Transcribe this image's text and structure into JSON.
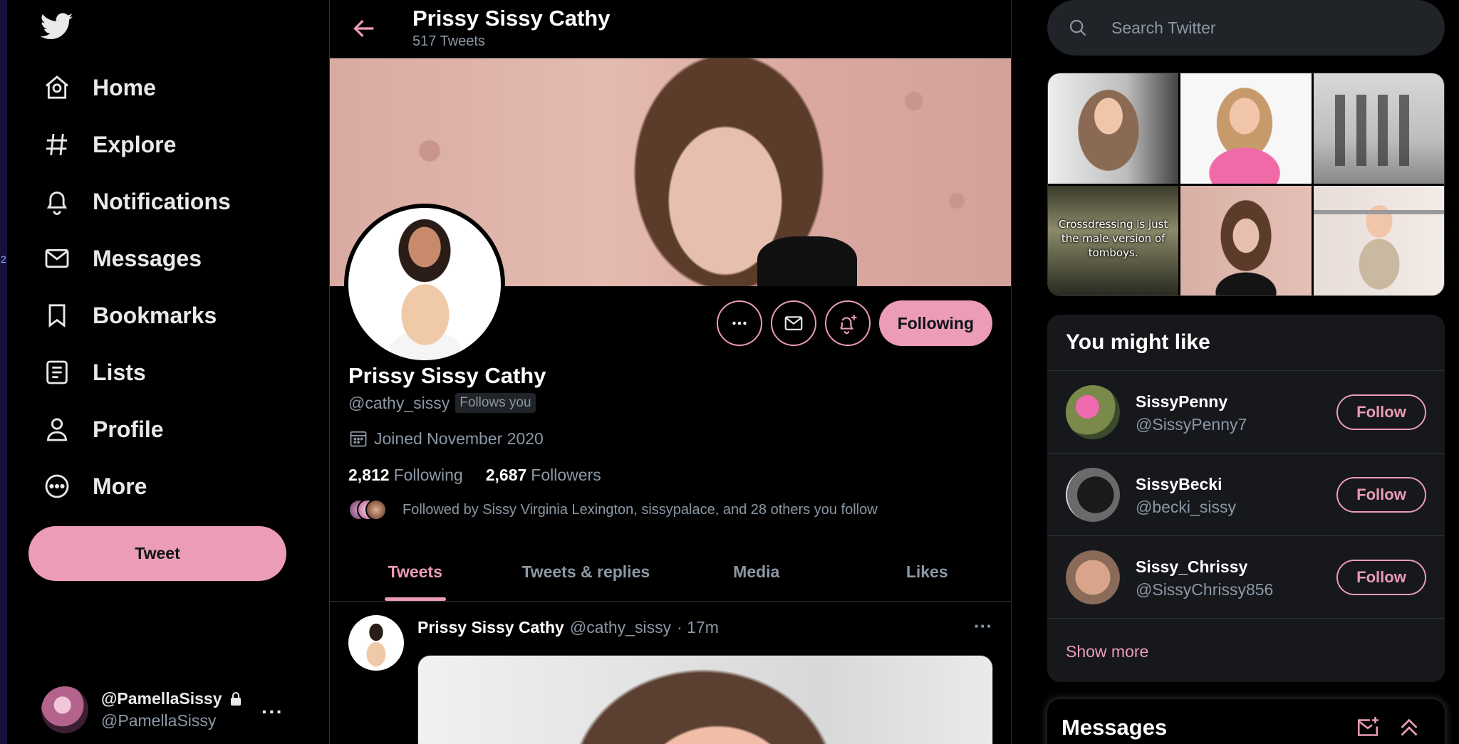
{
  "sidebar_marker": "2",
  "nav": {
    "items": [
      {
        "label": "Home",
        "icon": "home-icon"
      },
      {
        "label": "Explore",
        "icon": "hashtag-icon"
      },
      {
        "label": "Notifications",
        "icon": "bell-icon"
      },
      {
        "label": "Messages",
        "icon": "envelope-icon"
      },
      {
        "label": "Bookmarks",
        "icon": "bookmark-icon"
      },
      {
        "label": "Lists",
        "icon": "list-icon"
      },
      {
        "label": "Profile",
        "icon": "person-icon"
      },
      {
        "label": "More",
        "icon": "more-circle-icon"
      }
    ],
    "tweet_button": "Tweet",
    "account": {
      "name": "@PamellaSissy",
      "handle": "@PamellaSissy",
      "more": "···"
    }
  },
  "header": {
    "title": "Prissy Sissy Cathy",
    "subtitle": "517 Tweets"
  },
  "profile": {
    "name": "Prissy Sissy Cathy",
    "handle": "@cathy_sissy",
    "follows_you": "Follows you",
    "joined": "Joined November 2020",
    "following_count": "2,812",
    "following_label": "Following",
    "followers_count": "2,687",
    "followers_label": "Followers",
    "followed_by": "Followed by Sissy Virginia Lexington, sissypalace, and 28 others you follow",
    "following_button": "Following"
  },
  "tabs": [
    "Tweets",
    "Tweets & replies",
    "Media",
    "Likes"
  ],
  "active_tab": "Tweets",
  "tweet": {
    "name": "Prissy Sissy Cathy",
    "handle": "@cathy_sissy",
    "time": "· 17m"
  },
  "search": {
    "placeholder": "Search Twitter"
  },
  "media_grid": {
    "caption": "Crossdressing is just the male version of tomboys."
  },
  "who_to_follow": {
    "title": "You might like",
    "users": [
      {
        "name": "SissyPenny",
        "handle": "@SissyPenny7",
        "button": "Follow"
      },
      {
        "name": "SissyBecki",
        "handle": "@becki_sissy",
        "button": "Follow"
      },
      {
        "name": "Sissy_Chrissy",
        "handle": "@SissyChrissy856",
        "button": "Follow"
      }
    ],
    "show_more": "Show more"
  },
  "messages_drawer": {
    "title": "Messages"
  },
  "colors": {
    "accent": "#ec9cb5",
    "background": "#000000",
    "muted_text": "#8b98a5",
    "card": "#16181c"
  }
}
